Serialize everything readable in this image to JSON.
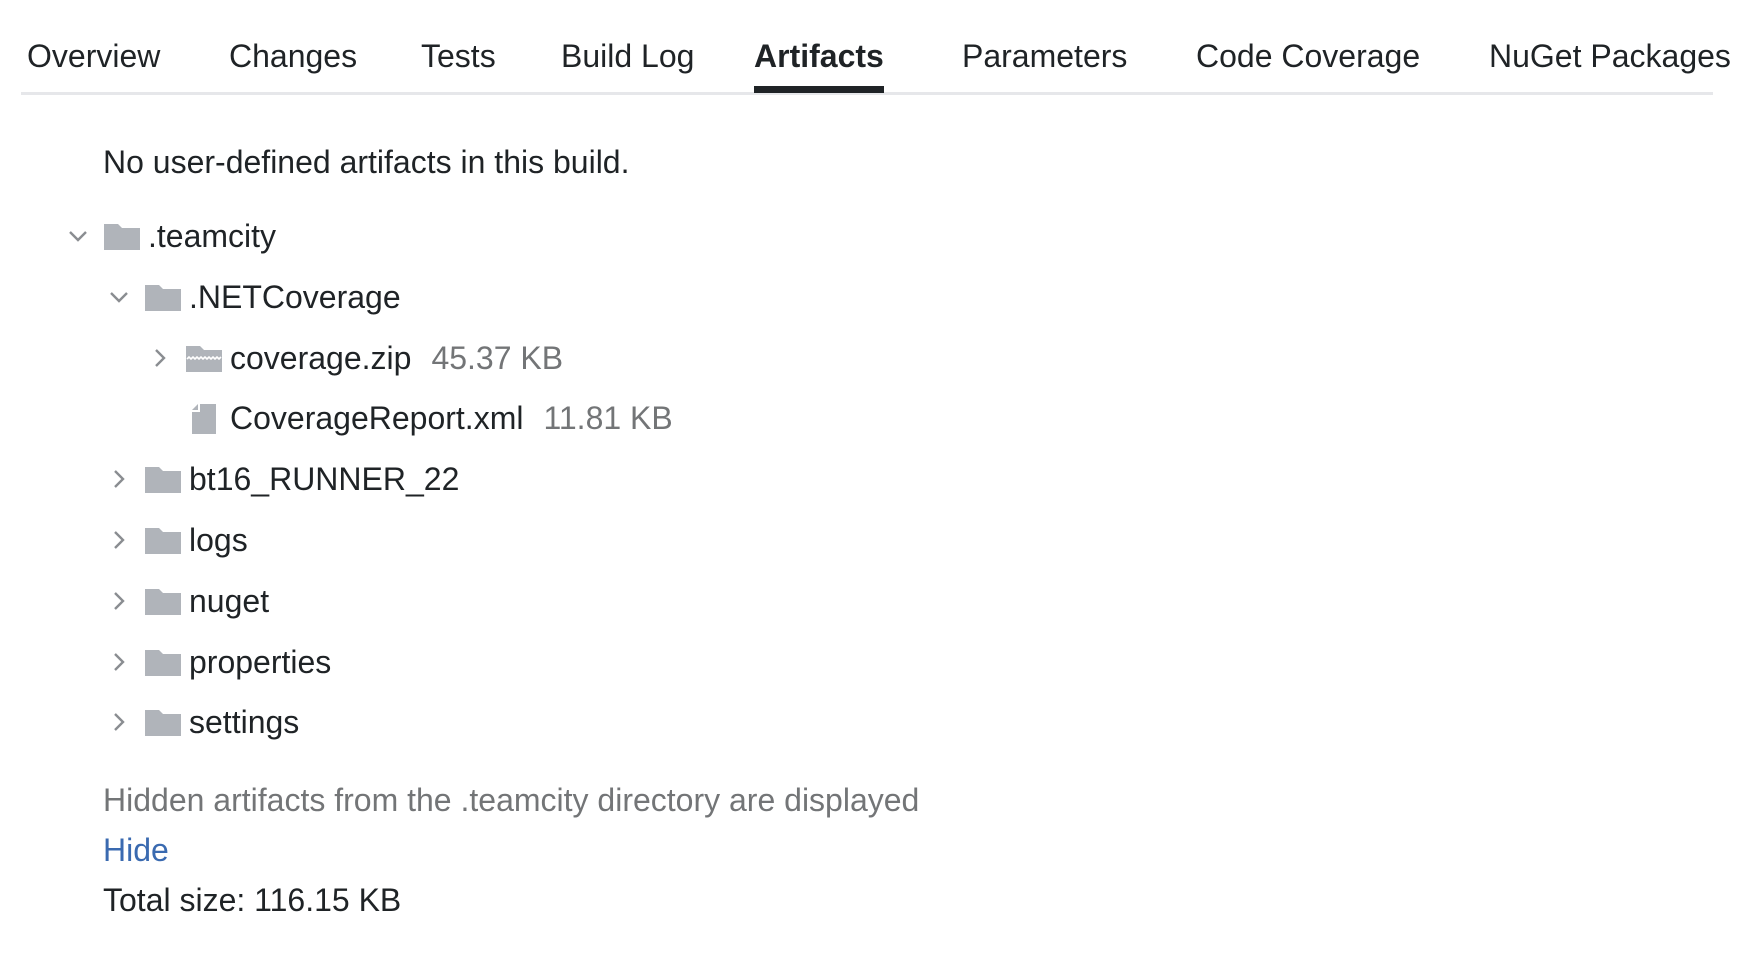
{
  "tabs": [
    {
      "label": "Overview",
      "active": false
    },
    {
      "label": "Changes",
      "active": false
    },
    {
      "label": "Tests",
      "active": false
    },
    {
      "label": "Build Log",
      "active": false
    },
    {
      "label": "Artifacts",
      "active": true
    },
    {
      "label": "Parameters",
      "active": false
    },
    {
      "label": "Code Coverage",
      "active": false
    },
    {
      "label": "NuGet Packages",
      "active": false
    }
  ],
  "artifacts": {
    "empty_message": "No user-defined artifacts in this build.",
    "tree": [
      {
        "name": ".teamcity",
        "type": "folder",
        "expanded": true,
        "depth": 0,
        "size": ""
      },
      {
        "name": ".NETCoverage",
        "type": "folder",
        "expanded": true,
        "depth": 1,
        "size": ""
      },
      {
        "name": "coverage.zip",
        "type": "archive",
        "expanded": false,
        "depth": 2,
        "size": "45.37 KB"
      },
      {
        "name": "CoverageReport.xml",
        "type": "file",
        "expanded": null,
        "depth": 2,
        "size": "11.81 KB"
      },
      {
        "name": "bt16_RUNNER_22",
        "type": "folder",
        "expanded": false,
        "depth": 1,
        "size": ""
      },
      {
        "name": "logs",
        "type": "folder",
        "expanded": false,
        "depth": 1,
        "size": ""
      },
      {
        "name": "nuget",
        "type": "folder",
        "expanded": false,
        "depth": 1,
        "size": ""
      },
      {
        "name": "properties",
        "type": "folder",
        "expanded": false,
        "depth": 1,
        "size": ""
      },
      {
        "name": "settings",
        "type": "folder",
        "expanded": false,
        "depth": 1,
        "size": ""
      }
    ],
    "hidden_note": "Hidden artifacts from the .teamcity directory are displayed",
    "hide_link": "Hide",
    "total_size": "Total size: 116.15 KB"
  },
  "colors": {
    "text": "#1f2326",
    "muted": "#737577",
    "link": "#3a6ab0",
    "icon": "#b0b4ba",
    "divider": "#e6e7ea"
  }
}
